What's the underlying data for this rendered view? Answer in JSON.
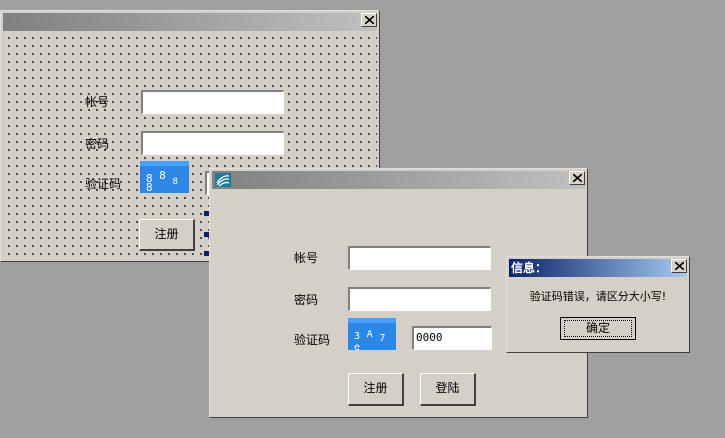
{
  "back_form": {
    "account_label": "帐号",
    "password_label": "密码",
    "captcha_label": "验证码",
    "captcha_chars": [
      "8",
      "8",
      "8",
      "8"
    ],
    "register_label": "注册"
  },
  "login_window": {
    "account_label": "帐号",
    "password_label": "密码",
    "captcha_label": "验证码",
    "captcha_chars": [
      "3",
      "A",
      "7",
      "e"
    ],
    "captcha_value": "0000",
    "register_label": "注册",
    "login_label": "登陆"
  },
  "message_box": {
    "title": "信息：",
    "message": "验证码错误，请区分大小写!",
    "ok_label": "确定"
  },
  "colors": {
    "desktop": "#a0a0a0",
    "window_face": "#d4d0c8",
    "captcha_bg": "#2d87e6",
    "msg_title_start": "#0a246a",
    "msg_title_end": "#a6caf0"
  }
}
